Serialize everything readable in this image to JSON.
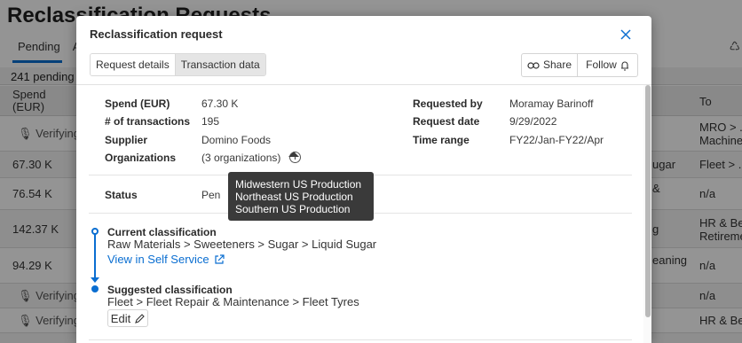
{
  "background": {
    "page_title": "Reclassification Requests",
    "tabs": [
      "Pending",
      "Ap"
    ],
    "pending_count": "241 pending",
    "columns": {
      "spend": "Spend\n(EUR)",
      "spend_line1": "Spend",
      "spend_line2": "(EUR)",
      "to": "To"
    },
    "rows": [
      {
        "spend": "Verifying",
        "right": "MRO > ...",
        "right2": "Machine"
      },
      {
        "spend": "67.30 K",
        "mid": "ugar",
        "right": "Fleet > ..."
      },
      {
        "spend": "76.54 K",
        "mid": "&",
        "right": "n/a"
      },
      {
        "spend": "142.37 K",
        "mid": "g",
        "right": "HR & Ber",
        "right2": "Retireme"
      },
      {
        "spend": "94.29 K",
        "mid": "eaning",
        "right": "n/a"
      },
      {
        "spend": "Verifying",
        "right": "n/a"
      },
      {
        "spend": "Verifying",
        "right": "HR & Ber"
      }
    ]
  },
  "modal": {
    "title": "Reclassification request",
    "tabs": {
      "details": "Request details",
      "transaction": "Transaction data"
    },
    "share_label": "Share",
    "follow_label": "Follow",
    "details": {
      "spend_label": "Spend (EUR)",
      "spend_value": "67.30 K",
      "transactions_label": "# of transactions",
      "transactions_value": "195",
      "supplier_label": "Supplier",
      "supplier_value": "Domino Foods",
      "orgs_label": "Organizations",
      "orgs_value": "(3 organizations)",
      "requested_by_label": "Requested by",
      "requested_by_value": "Moramay Barinoff",
      "request_date_label": "Request date",
      "request_date_value": "9/29/2022",
      "time_range_label": "Time range",
      "time_range_value": "FY22/Jan-FY22/Apr"
    },
    "status": {
      "label": "Status",
      "value": "Pen"
    },
    "tooltip": {
      "lines": [
        "Midwestern US Production",
        "Northeast US Production",
        "Southern US Production"
      ]
    },
    "current": {
      "title": "Current classification",
      "path": "Raw Materials > Sweeteners > Sugar > Liquid Sugar",
      "link": "View in Self Service"
    },
    "suggested": {
      "title": "Suggested classification",
      "path": "Fleet > Fleet Repair & Maintenance > Fleet Tyres",
      "edit_label": "Edit"
    }
  }
}
